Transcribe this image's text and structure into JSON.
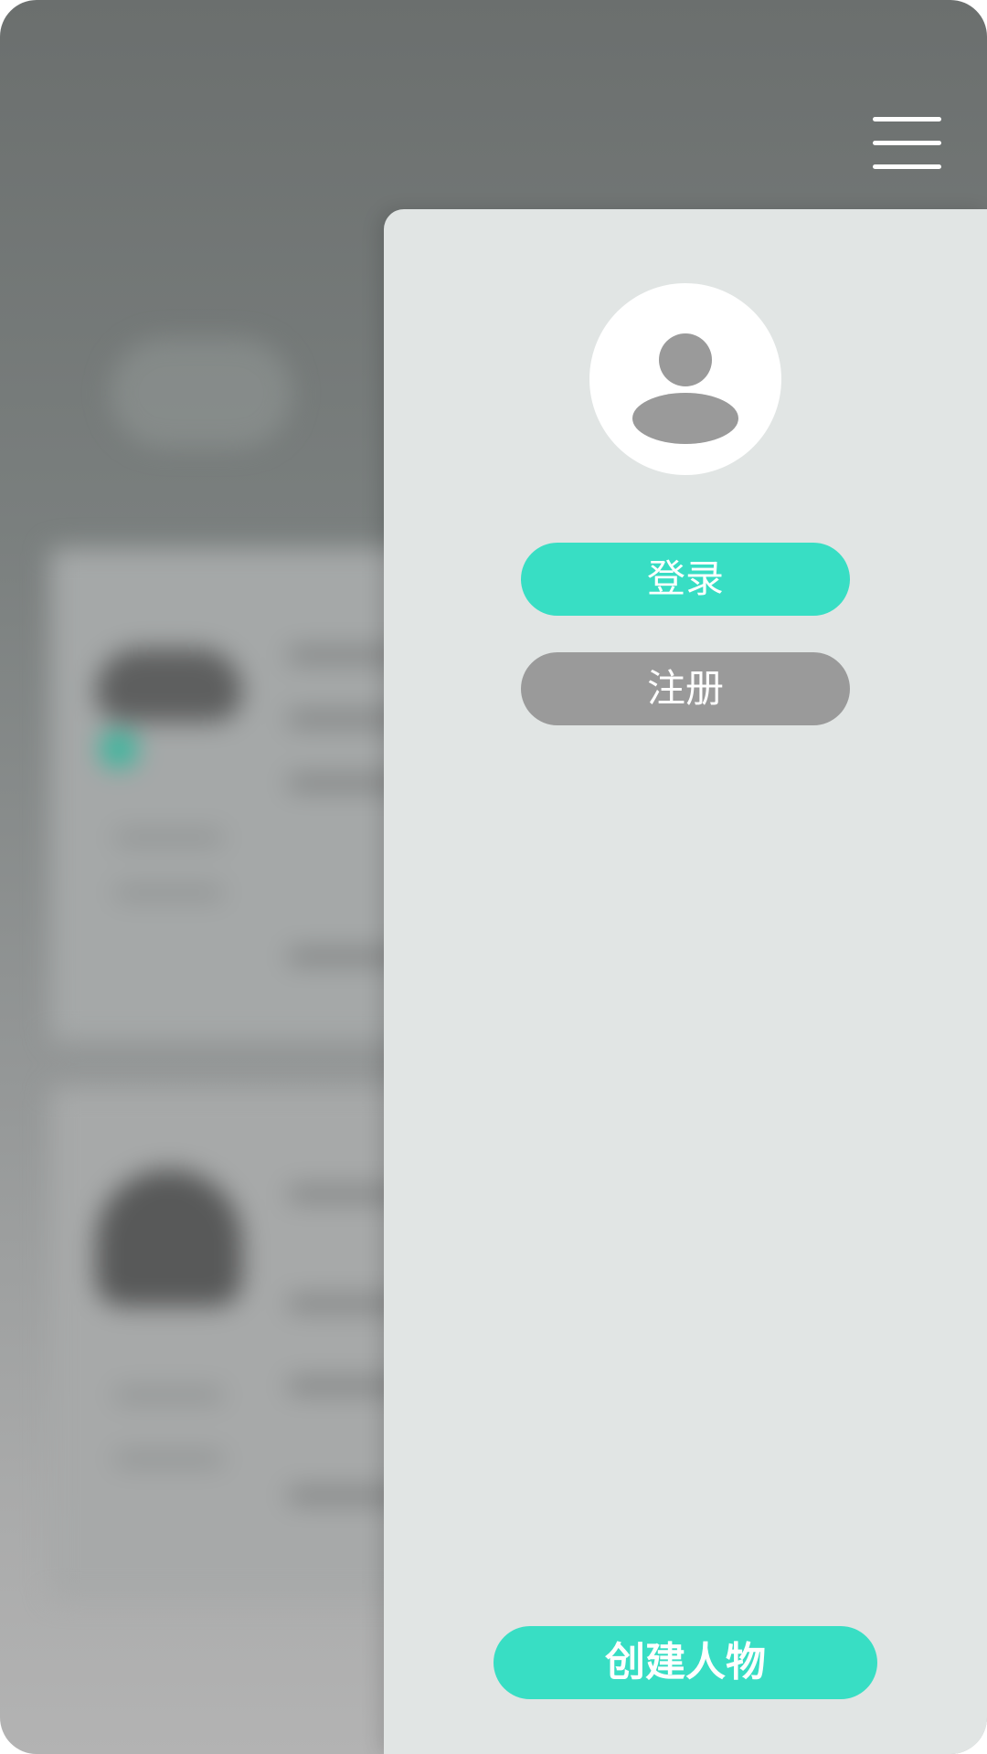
{
  "drawer": {
    "login_label": "登录",
    "register_label": "注册",
    "create_character_label": "创建人物"
  },
  "icons": {
    "menu": "hamburger-menu-icon",
    "avatar": "user-avatar-icon"
  },
  "colors": {
    "accent": "#38dec4",
    "secondary_button": "#9a9a9a",
    "drawer_background": "#e1e5e4",
    "avatar_background": "#ffffff",
    "avatar_glyph": "#9a9a9a"
  }
}
